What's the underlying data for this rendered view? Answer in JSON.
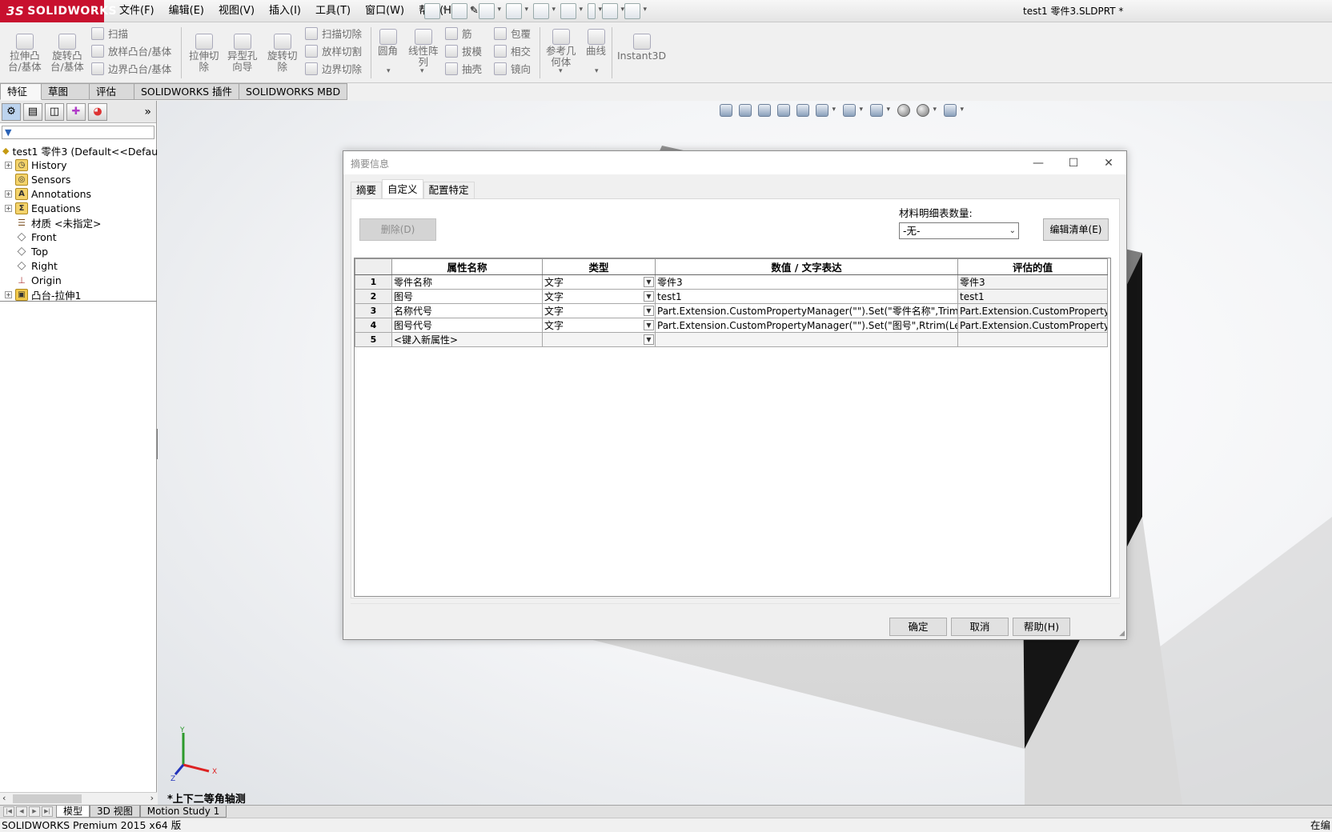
{
  "app": {
    "logo_text": "SOLIDWORKS",
    "logo_prefix": "3S",
    "brand_color": "#c8102e",
    "menus": [
      "文件(F)",
      "编辑(E)",
      "视图(V)",
      "插入(I)",
      "工具(T)",
      "窗口(W)",
      "帮助(H)"
    ],
    "document_title": "test1  零件3.SLDPRT *"
  },
  "ribbon": {
    "extrude_boss": "拉伸凸\n台/基体",
    "revolve_boss": "旋转凸\n台/基体",
    "sweep": "扫描",
    "loft_boss": "放样凸台/基体",
    "boundary_boss": "边界凸台/基体",
    "extrude_cut": "拉伸切\n除",
    "hole_wizard": "异型孔\n向导",
    "revolve_cut": "旋转切\n除",
    "swept_cut": "扫描切除",
    "lofted_cut": "放样切割",
    "boundary_cut": "边界切除",
    "fillet": "圆角",
    "linear_pattern": "线性阵\n列",
    "rib": "筋",
    "draft": "拔模",
    "shell": "抽壳",
    "wrap": "包覆",
    "intersect": "相交",
    "mirror": "镜向",
    "ref_geometry": "参考几\n何体",
    "curves": "曲线",
    "instant3d": "Instant3D"
  },
  "cm_tabs": [
    "特征",
    "草图",
    "评估",
    "SOLIDWORKS 插件",
    "SOLIDWORKS MBD"
  ],
  "tree": {
    "root": "test1  零件3  (Default<<Defau",
    "items": [
      {
        "label": "History",
        "icon": "history-icon"
      },
      {
        "label": "Sensors",
        "icon": "sensors-icon"
      },
      {
        "label": "Annotations",
        "icon": "annotations-icon"
      },
      {
        "label": "Equations",
        "icon": "equations-icon"
      },
      {
        "label": "材质 <未指定>",
        "icon": "material-icon"
      },
      {
        "label": "Front",
        "icon": "plane-icon"
      },
      {
        "label": "Top",
        "icon": "plane-icon"
      },
      {
        "label": "Right",
        "icon": "plane-icon"
      },
      {
        "label": "Origin",
        "icon": "origin-icon"
      },
      {
        "label": "凸台-拉伸1",
        "icon": "extrude-feature-icon"
      }
    ]
  },
  "viewport": {
    "view_label": "*上下二等角轴测"
  },
  "bottom_tabs": [
    "模型",
    "3D 视图",
    "Motion Study 1"
  ],
  "status": {
    "left": "SOLIDWORKS Premium 2015 x64 版",
    "right": "在编"
  },
  "dialog": {
    "title": "摘要信息",
    "tabs": [
      "摘要",
      "自定义",
      "配置特定"
    ],
    "delete_button": "删除(D)",
    "bom_label": "材料明细表数量:",
    "bom_value": "-无-",
    "edit_list_button": "编辑清单(E)",
    "columns": [
      "属性名称",
      "类型",
      "数值 / 文字表达",
      "评估的值"
    ],
    "rows": [
      {
        "num": "1",
        "name": "零件名称",
        "type": "文字",
        "value": "零件3",
        "evaluated": "零件3"
      },
      {
        "num": "2",
        "name": "图号",
        "type": "文字",
        "value": "test1",
        "evaluated": "test1"
      },
      {
        "num": "3",
        "name": "名称代号",
        "type": "文字",
        "value": "Part.Extension.CustomPropertyManager(\"\").Set(\"零件名称\",Trim(Replac",
        "evaluated": "Part.Extension.CustomPropertyMan"
      },
      {
        "num": "4",
        "name": "图号代号",
        "type": "文字",
        "value": "Part.Extension.CustomPropertyManager(\"\").Set(\"图号\",Rtrim(Left(Part.G",
        "evaluated": "Part.Extension.CustomPropertyMan"
      }
    ],
    "new_row": {
      "num": "5",
      "placeholder": "<键入新属性>"
    },
    "ok_button": "确定",
    "cancel_button": "取消",
    "help_button": "帮助(H)"
  }
}
